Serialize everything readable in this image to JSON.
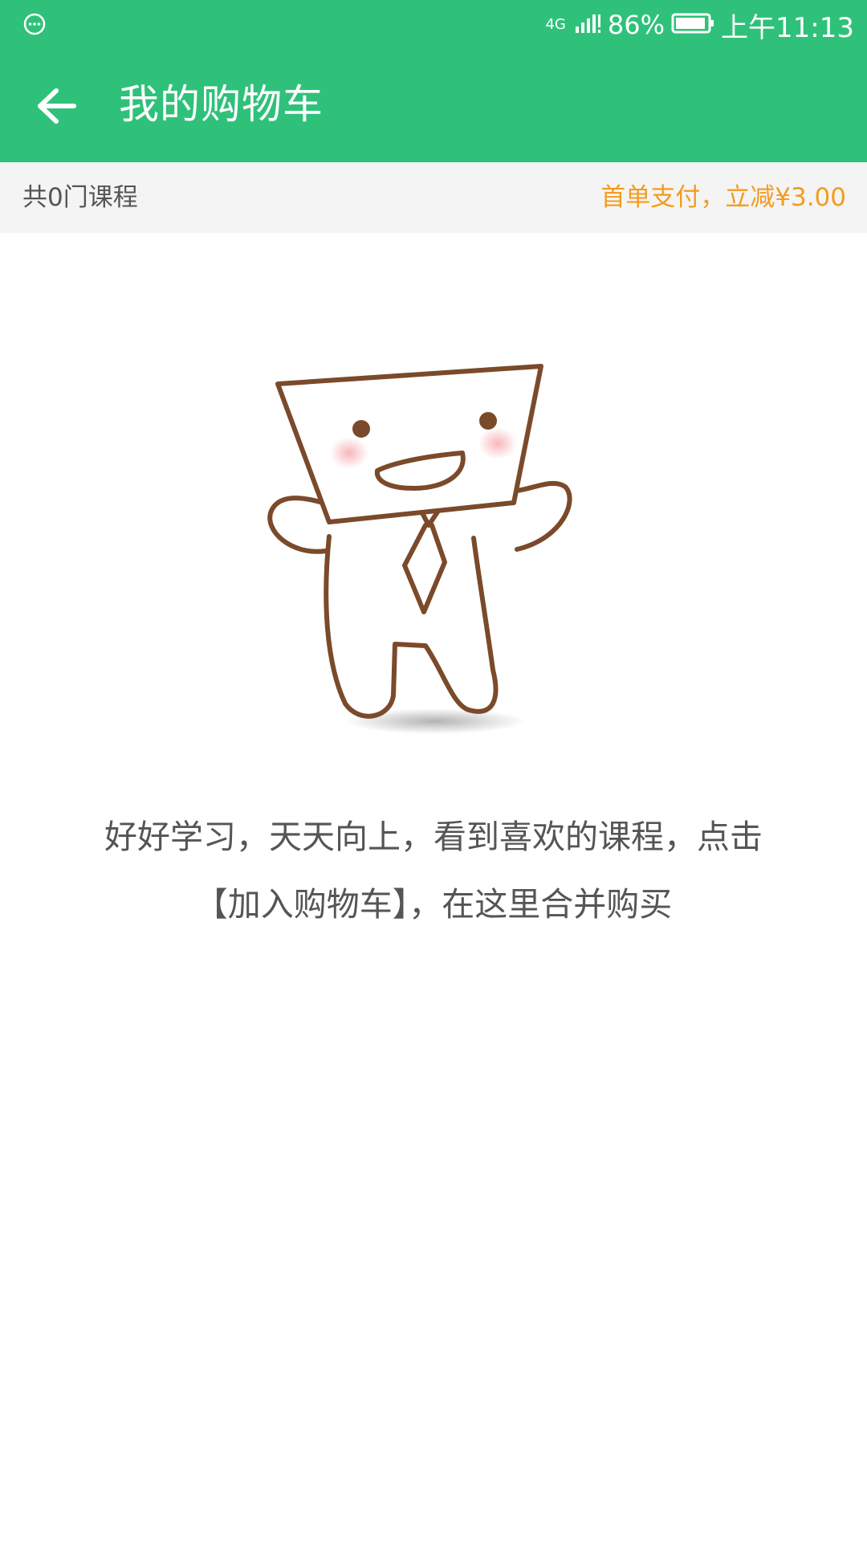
{
  "status_bar": {
    "network": "4G",
    "battery_percent": "86%",
    "time": "上午11:13",
    "left_icon": "chat-bubble-icon",
    "battery_icon": "battery-icon",
    "signal_icon": "signal-icon"
  },
  "app_bar": {
    "title": "我的购物车",
    "back_icon": "back-arrow-icon",
    "background_color": "#2fc17a"
  },
  "summary": {
    "course_count": "共0门课程",
    "promo": "首单支付，立减¥3.00",
    "promo_color": "#f39c1f"
  },
  "empty_state": {
    "illustration": "mascot-illustration",
    "line1": "好好学习，天天向上，看到喜欢的课程，点击",
    "line2": "【加入购物车】，在这里合并购买"
  }
}
